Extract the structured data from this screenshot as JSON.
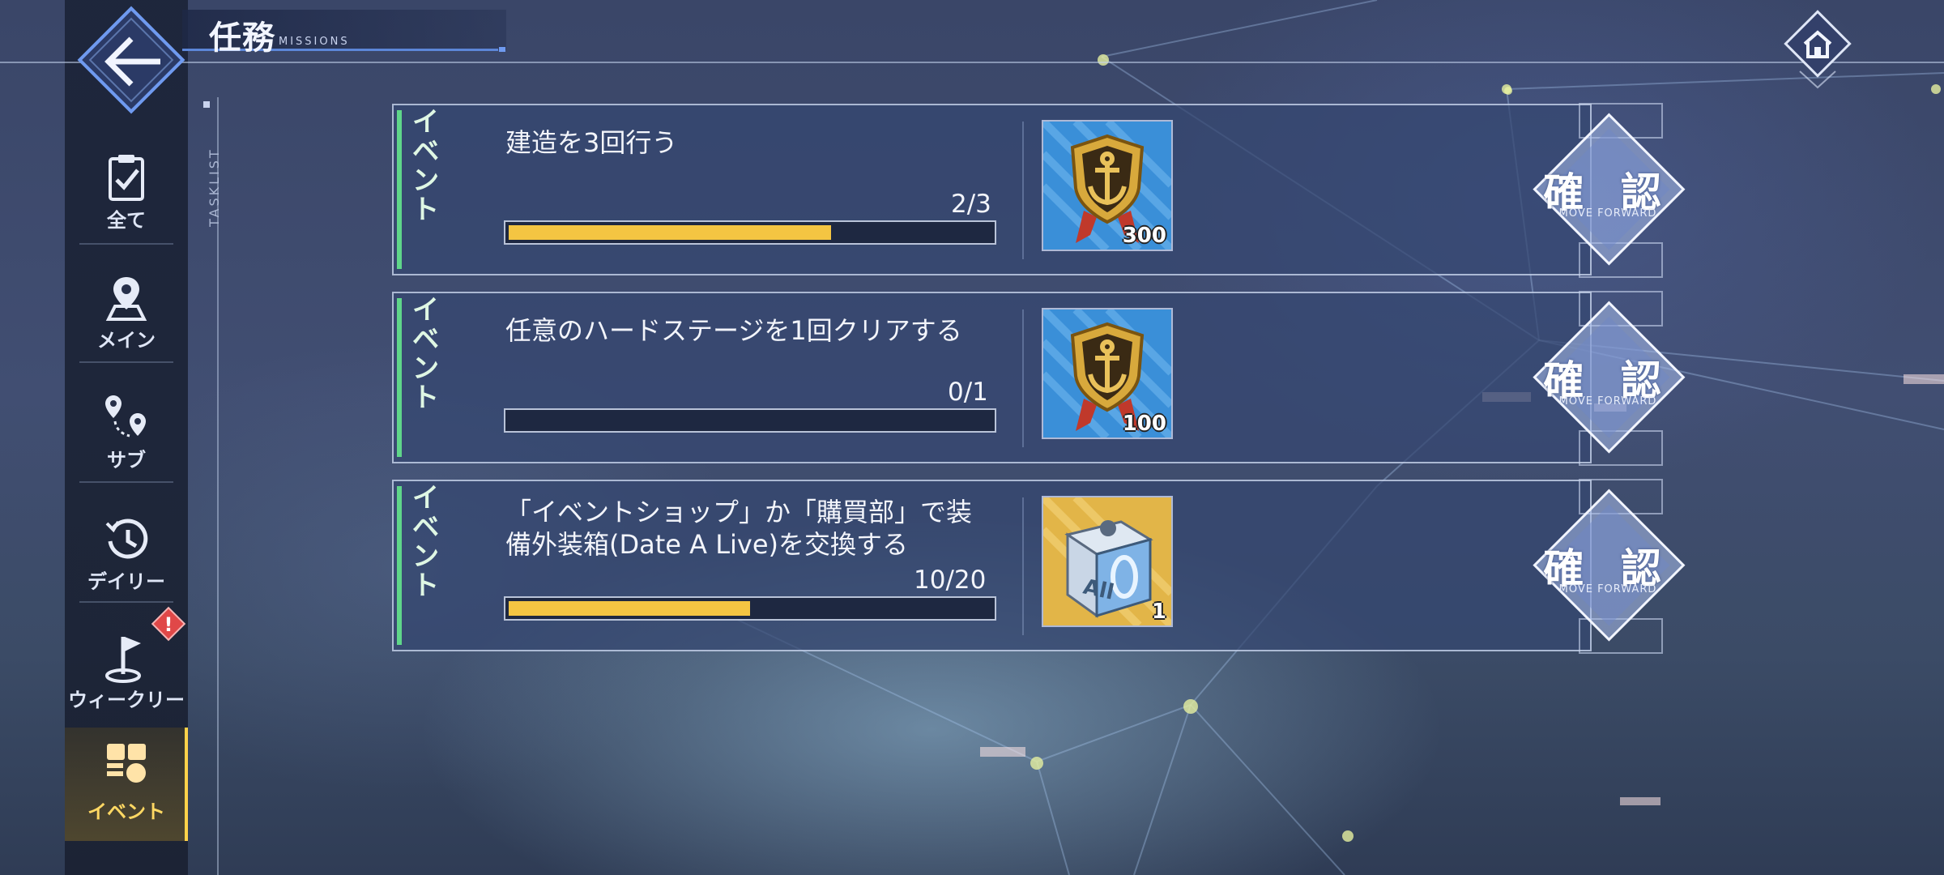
{
  "header": {
    "title_jp": "任務",
    "title_en": "MISSIONS"
  },
  "sidebar": {
    "tasklist_label": "TASKLIST",
    "items": [
      {
        "label": "全て",
        "icon": "clipboard-check-icon"
      },
      {
        "label": "メイン",
        "icon": "map-pin-icon"
      },
      {
        "label": "サブ",
        "icon": "route-pins-icon"
      },
      {
        "label": "デイリー",
        "icon": "clock-history-icon"
      },
      {
        "label": "ウィークリー",
        "icon": "flag-icon",
        "alert": "!"
      },
      {
        "label": "イベント",
        "icon": "event-blocks-icon",
        "active": true
      }
    ]
  },
  "missions": [
    {
      "category": "イベント",
      "title": "建造を3回行う",
      "progress_text": "2/3",
      "progress": 0.667,
      "reward": {
        "icon": "anchor-medal-icon",
        "qty": "300"
      },
      "button": {
        "label_jp": "確 認",
        "label_en": "MOVE FORWARD"
      }
    },
    {
      "category": "イベント",
      "title": "任意のハードステージを1回クリアする",
      "progress_text": "0/1",
      "progress": 0,
      "reward": {
        "icon": "anchor-medal-icon",
        "qty": "100"
      },
      "button": {
        "label_jp": "確 認",
        "label_en": "MOVE FORWARD"
      }
    },
    {
      "category": "イベント",
      "title": "「イベントショップ」か「購買部」で装備外装箱(Date A Live)を交換する",
      "progress_text": "10/20",
      "progress": 0.5,
      "reward": {
        "icon": "all-box-icon",
        "qty": "1"
      },
      "button": {
        "label_jp": "確 認",
        "label_en": "MOVE FORWARD"
      }
    }
  ],
  "colors": {
    "progress_fill": "#f4c542",
    "category_accent": "#5fd68a",
    "active_tab": "#ffd24a",
    "alert": "#e04848"
  }
}
